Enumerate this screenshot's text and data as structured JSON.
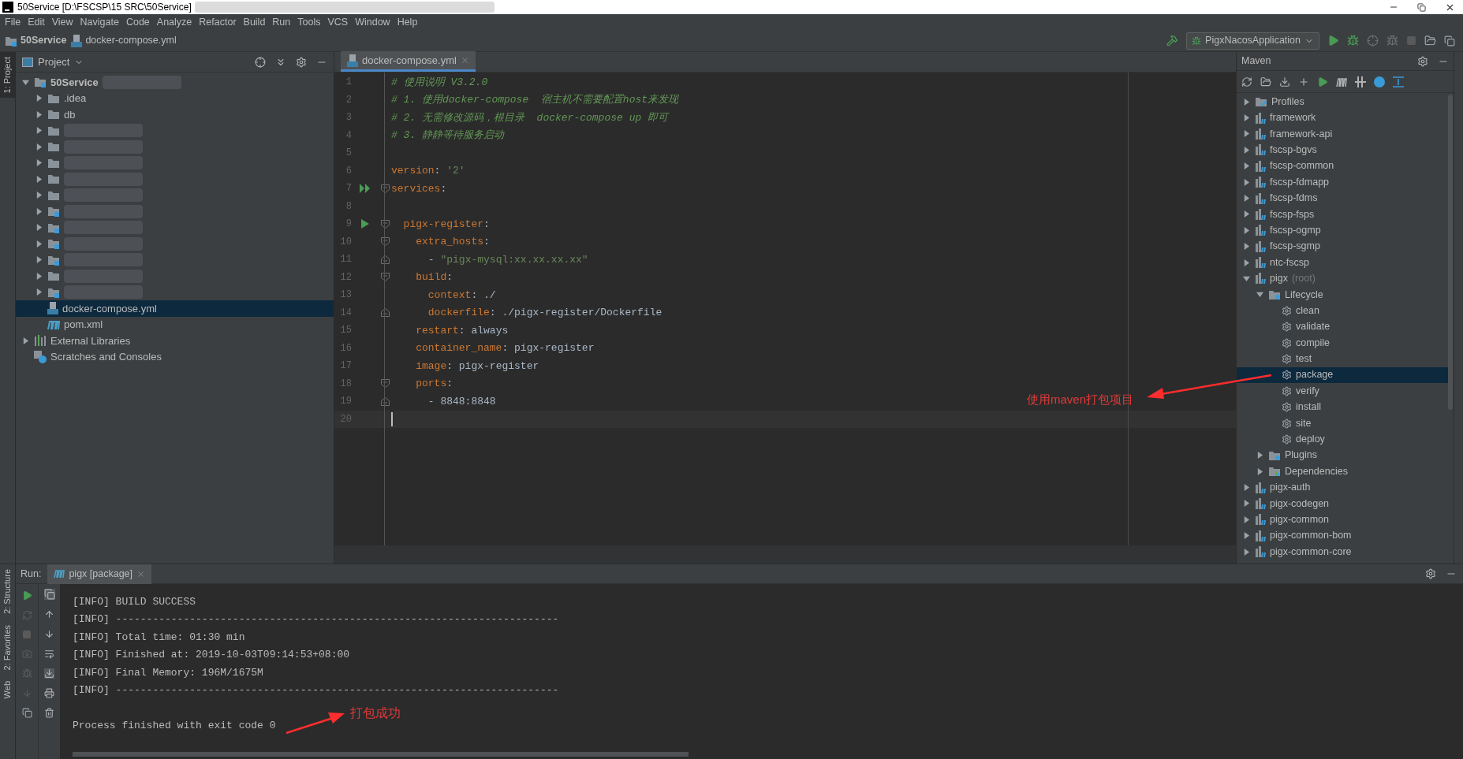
{
  "window": {
    "title": "50Service [D:\\FSCSP\\15 SRC\\50Service]"
  },
  "menu": [
    "File",
    "Edit",
    "View",
    "Navigate",
    "Code",
    "Analyze",
    "Refactor",
    "Build",
    "Run",
    "Tools",
    "VCS",
    "Window",
    "Help"
  ],
  "breadcrumbs": [
    "50Service",
    "docker-compose.yml"
  ],
  "run_config": "PigxNacosApplication",
  "left_strip": [
    "1: Project"
  ],
  "project_panel": {
    "title": "Project",
    "tree": [
      {
        "kind": "module",
        "label": "50Service",
        "expanded": true,
        "selected": false,
        "redacted": true,
        "children": [
          {
            "kind": "folder",
            "label": ".idea",
            "expanded": false,
            "selected": false
          },
          {
            "kind": "folder",
            "label": "db",
            "expanded": false,
            "selected": false
          },
          {
            "kind": "folder",
            "expanded": false,
            "selected": false,
            "redacted": true
          },
          {
            "kind": "folder",
            "expanded": false,
            "selected": false,
            "redacted": true
          },
          {
            "kind": "folder",
            "expanded": false,
            "selected": false,
            "redacted": true
          },
          {
            "kind": "folder",
            "expanded": false,
            "selected": false,
            "redacted": true
          },
          {
            "kind": "folder",
            "expanded": false,
            "selected": false,
            "redacted": true
          },
          {
            "kind": "module",
            "expanded": false,
            "selected": false,
            "redacted": true
          },
          {
            "kind": "module",
            "expanded": false,
            "selected": false,
            "redacted": true
          },
          {
            "kind": "module",
            "expanded": false,
            "selected": false,
            "redacted": true
          },
          {
            "kind": "module",
            "expanded": false,
            "selected": false,
            "redacted": true
          },
          {
            "kind": "folder",
            "expanded": false,
            "selected": false,
            "redacted": true
          },
          {
            "kind": "module",
            "expanded": false,
            "selected": false,
            "redacted": true
          },
          {
            "kind": "docker-file",
            "label": "docker-compose.yml",
            "selected": true
          },
          {
            "kind": "maven-file",
            "label": "pom.xml",
            "selected": false
          }
        ]
      },
      {
        "kind": "libraries",
        "label": "External Libraries",
        "expanded": false,
        "selected": false
      },
      {
        "kind": "scratches",
        "label": "Scratches and Consoles",
        "selected": false
      }
    ]
  },
  "editor": {
    "tab": {
      "label": "docker-compose.yml",
      "selected": true
    },
    "lines": [
      {
        "number": "1",
        "segments": [
          {
            "kind": "comment",
            "text": "# 使用说明 V3.2.0"
          }
        ]
      },
      {
        "number": "2",
        "segments": [
          {
            "kind": "comment",
            "text": "# 1. 使用docker-compose  宿主机不需要配置host来发现"
          }
        ]
      },
      {
        "number": "3",
        "segments": [
          {
            "kind": "comment",
            "text": "# 2. 无需修改源码，根目录  docker-compose up 即可"
          }
        ]
      },
      {
        "number": "4",
        "segments": [
          {
            "kind": "comment",
            "text": "# 3. 静静等待服务启动"
          }
        ]
      },
      {
        "number": "5"
      },
      {
        "number": "6",
        "segments": [
          {
            "kind": "key",
            "text": "version"
          },
          {
            "kind": "value",
            "text": ": "
          },
          {
            "kind": "string",
            "text": "'2'"
          }
        ]
      },
      {
        "number": "7",
        "gutter": {
          "kind": "run-all"
        },
        "fold": {
          "kind": "start"
        },
        "segments": [
          {
            "kind": "key",
            "text": "services"
          },
          {
            "kind": "value",
            "text": ":"
          }
        ]
      },
      {
        "number": "8"
      },
      {
        "number": "9",
        "gutter": {
          "kind": "run"
        },
        "fold": {
          "kind": "start"
        },
        "segments": [
          {
            "kind": "key",
            "text": "  pigx-register"
          },
          {
            "kind": "value",
            "text": ":"
          }
        ]
      },
      {
        "number": "10",
        "fold": {
          "kind": "start"
        },
        "segments": [
          {
            "kind": "key",
            "text": "    extra_hosts"
          },
          {
            "kind": "value",
            "text": ":"
          }
        ]
      },
      {
        "number": "11",
        "fold": {
          "kind": "end"
        },
        "segments": [
          {
            "kind": "value",
            "text": "      - "
          },
          {
            "kind": "string",
            "text": "\"pigx-mysql:xx.xx.xx.xx\""
          }
        ]
      },
      {
        "number": "12",
        "fold": {
          "kind": "start"
        },
        "segments": [
          {
            "kind": "key",
            "text": "    build"
          },
          {
            "kind": "value",
            "text": ":"
          }
        ]
      },
      {
        "number": "13",
        "segments": [
          {
            "kind": "key",
            "text": "      context"
          },
          {
            "kind": "value",
            "text": ": ./"
          }
        ]
      },
      {
        "number": "14",
        "fold": {
          "kind": "end"
        },
        "segments": [
          {
            "kind": "key",
            "text": "      dockerfile"
          },
          {
            "kind": "value",
            "text": ": ./pigx-register/Dockerfile"
          }
        ]
      },
      {
        "number": "15",
        "segments": [
          {
            "kind": "key",
            "text": "    restart"
          },
          {
            "kind": "value",
            "text": ": always"
          }
        ]
      },
      {
        "number": "16",
        "segments": [
          {
            "kind": "key",
            "text": "    container_name"
          },
          {
            "kind": "value",
            "text": ": pigx-register"
          }
        ]
      },
      {
        "number": "17",
        "segments": [
          {
            "kind": "key",
            "text": "    image"
          },
          {
            "kind": "value",
            "text": ": pigx-register"
          }
        ]
      },
      {
        "number": "18",
        "fold": {
          "kind": "start"
        },
        "segments": [
          {
            "kind": "key",
            "text": "    ports"
          },
          {
            "kind": "value",
            "text": ":"
          }
        ]
      },
      {
        "number": "19",
        "fold": {
          "kind": "end"
        },
        "segments": [
          {
            "kind": "value",
            "text": "      - 8848:8848"
          }
        ]
      },
      {
        "number": "20",
        "current": true
      }
    ]
  },
  "maven_panel": {
    "title": "Maven",
    "tree": [
      {
        "kind": "profiles",
        "label": "Profiles",
        "expanded": false,
        "selected": false
      },
      {
        "kind": "module",
        "label": "framework",
        "expanded": false,
        "selected": false
      },
      {
        "kind": "module",
        "label": "framework-api",
        "expanded": false,
        "selected": false
      },
      {
        "kind": "module",
        "label": "fscsp-bgvs",
        "expanded": false,
        "selected": false
      },
      {
        "kind": "module",
        "label": "fscsp-common",
        "expanded": false,
        "selected": false
      },
      {
        "kind": "module",
        "label": "fscsp-fdmapp",
        "expanded": false,
        "selected": false
      },
      {
        "kind": "module",
        "label": "fscsp-fdms",
        "expanded": false,
        "selected": false
      },
      {
        "kind": "module",
        "label": "fscsp-fsps",
        "expanded": false,
        "selected": false
      },
      {
        "kind": "module",
        "label": "fscsp-ogmp",
        "expanded": false,
        "selected": false
      },
      {
        "kind": "module",
        "label": "fscsp-sgmp",
        "expanded": false,
        "selected": false
      },
      {
        "kind": "module",
        "label": "ntc-fscsp",
        "expanded": false,
        "selected": false
      },
      {
        "kind": "module",
        "label": "pigx",
        "note": "(root)",
        "expanded": true,
        "selected": false,
        "children": [
          {
            "kind": "lifecycle",
            "label": "Lifecycle",
            "expanded": true,
            "selected": false,
            "children": [
              {
                "kind": "goal",
                "label": "clean",
                "selected": false
              },
              {
                "kind": "goal",
                "label": "validate",
                "selected": false
              },
              {
                "kind": "goal",
                "label": "compile",
                "selected": false
              },
              {
                "kind": "goal",
                "label": "test",
                "selected": false
              },
              {
                "kind": "goal",
                "label": "package",
                "selected": true
              },
              {
                "kind": "goal",
                "label": "verify",
                "selected": false
              },
              {
                "kind": "goal",
                "label": "install",
                "selected": false
              },
              {
                "kind": "goal",
                "label": "site",
                "selected": false
              },
              {
                "kind": "goal",
                "label": "deploy",
                "selected": false
              }
            ]
          },
          {
            "kind": "plugins",
            "label": "Plugins",
            "expanded": false,
            "selected": false
          },
          {
            "kind": "dependencies",
            "label": "Dependencies",
            "expanded": false,
            "selected": false
          }
        ]
      },
      {
        "kind": "module",
        "label": "pigx-auth",
        "expanded": false,
        "selected": false
      },
      {
        "kind": "module",
        "label": "pigx-codegen",
        "expanded": false,
        "selected": false
      },
      {
        "kind": "module",
        "label": "pigx-common",
        "expanded": false,
        "selected": false
      },
      {
        "kind": "module",
        "label": "pigx-common-bom",
        "expanded": false,
        "selected": false
      },
      {
        "kind": "module",
        "label": "pigx-common-core",
        "expanded": false,
        "selected": false
      }
    ]
  },
  "run_panel": {
    "label": "Run:",
    "tab": {
      "label": "pigx [package]",
      "selected": true
    },
    "side_labels": [
      "2: Structure",
      "2: Favorites",
      "Web"
    ],
    "console": [
      {
        "kind": "log",
        "text": "[INFO] BUILD SUCCESS"
      },
      {
        "kind": "log",
        "text": "[INFO] ------------------------------------------------------------------------"
      },
      {
        "kind": "log",
        "text": "[INFO] Total time: 01:30 min"
      },
      {
        "kind": "log",
        "text": "[INFO] Finished at: 2019-10-03T09:14:53+08:00"
      },
      {
        "kind": "log",
        "text": "[INFO] Final Memory: 196M/1675M"
      },
      {
        "kind": "log",
        "text": "[INFO] ------------------------------------------------------------------------"
      },
      {
        "kind": "exit",
        "text": "Process finished with exit code 0"
      }
    ]
  },
  "annotations": [
    {
      "text": "使用maven打包项目"
    },
    {
      "text": "打包成功"
    }
  ]
}
